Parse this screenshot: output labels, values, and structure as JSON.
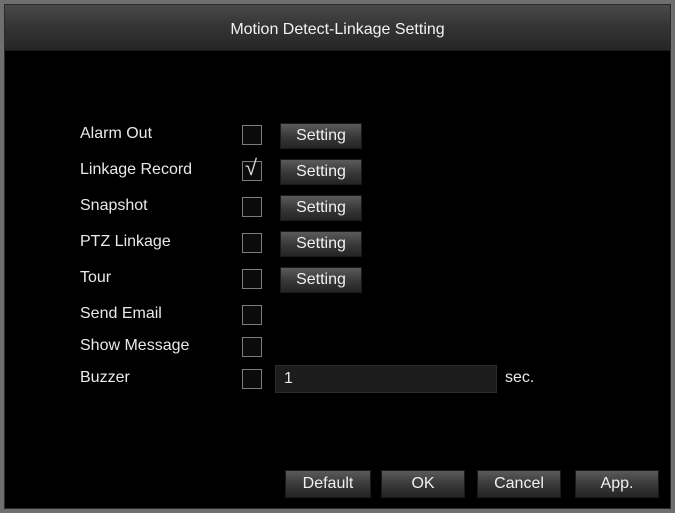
{
  "dialog": {
    "title": "Motion Detect-Linkage Setting"
  },
  "options": [
    {
      "label": "Alarm Out",
      "checked": false,
      "setting": "Setting"
    },
    {
      "label": "Linkage Record",
      "checked": true,
      "setting": "Setting"
    },
    {
      "label": "Snapshot",
      "checked": false,
      "setting": "Setting"
    },
    {
      "label": "PTZ Linkage",
      "checked": false,
      "setting": "Setting"
    },
    {
      "label": "Tour",
      "checked": false,
      "setting": "Setting"
    },
    {
      "label": "Send Email",
      "checked": false
    },
    {
      "label": "Show Message",
      "checked": false
    },
    {
      "label": "Buzzer",
      "checked": false
    }
  ],
  "buzzer": {
    "duration": "1",
    "unit": "sec."
  },
  "footer": {
    "default_label": "Default",
    "ok_label": "OK",
    "cancel_label": "Cancel",
    "apply_label": "App."
  },
  "icons": {
    "checked": "check-icon"
  }
}
